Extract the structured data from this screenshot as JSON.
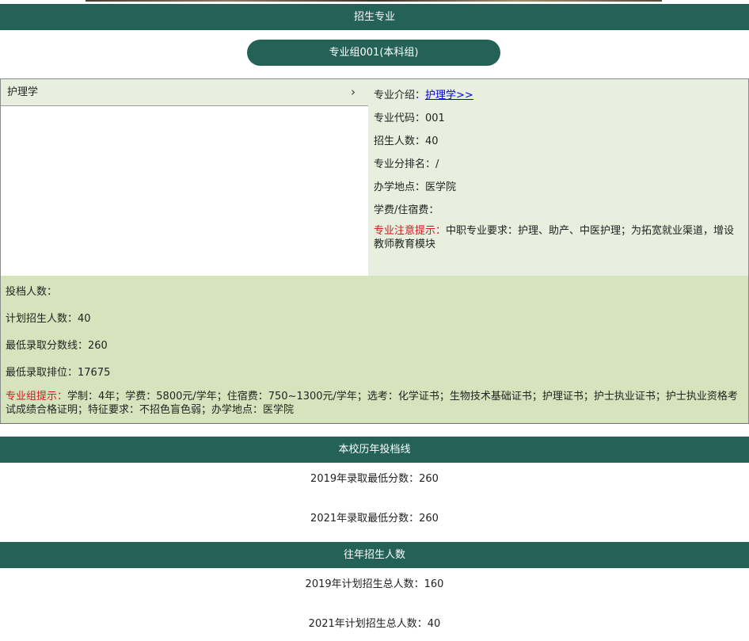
{
  "sections": {
    "majors_title": "招生专业",
    "history_title": "本校历年投档线",
    "enroll_title": "往年招生人数"
  },
  "group": {
    "button_label": "专业组001(本科组)"
  },
  "majors": [
    {
      "name": "护理学",
      "chevron": "›"
    }
  ],
  "detail": {
    "intro_label": "专业介绍：",
    "intro_link": "护理学>>",
    "code": "专业代码：001",
    "enroll_count": "招生人数：40",
    "rank": "专业分排名：/",
    "location": "办学地点：医学院",
    "fees": "学费/住宿费：",
    "warning_label": "专业注意提示：",
    "warning_text": "中职专业要求：护理、助产、中医护理；为拓宽就业渠道，增设教师教育模块"
  },
  "group_stats": {
    "filed": "投档人数：",
    "planned": "计划招生人数：40",
    "min_score": "最低录取分数线：260",
    "min_rank": "最低录取排位：17675",
    "note_label": "专业组提示：",
    "note_text": "学制：4年；学费：5800元/学年；住宿费：750~1300元/学年；选考：化学证书；生物技术基础证书；护理证书；护士执业证书；护士执业资格考试成绩合格证明；特征要求：不招色盲色弱；办学地点：医学院"
  },
  "history": [
    "2019年录取最低分数：260",
    "2021年录取最低分数：260"
  ],
  "enroll_history": [
    "2019年计划招生总人数：160",
    "2021年计划招生总人数：40"
  ],
  "colors": {
    "header_bg": "#246257",
    "detail_bg": "#e8efde",
    "stats_bg": "#d6e4bd",
    "warning": "#d0181f",
    "link": "#0000ee"
  }
}
